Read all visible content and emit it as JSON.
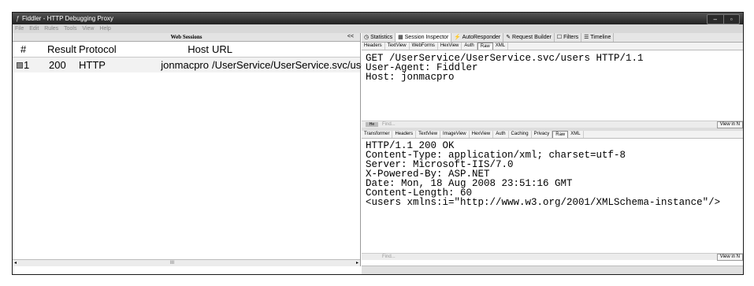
{
  "window": {
    "title": "Fiddler - HTTP Debugging Proxy",
    "minimize": "–",
    "restore": "▫"
  },
  "menu": [
    "File",
    "Edit",
    "Rules",
    "Tools",
    "View",
    "Help"
  ],
  "sessions": {
    "header": "Web Sessions",
    "collapse": "<<",
    "columns": {
      "num": "#",
      "result": "Result",
      "protocol": "Protocol",
      "host": "Host",
      "url": "URL"
    },
    "rows": [
      {
        "num": "1",
        "result": "200",
        "protocol": "HTTP",
        "host": "jonmacpro",
        "url": "/UserService/UserService.svc/users"
      }
    ],
    "scroll": {
      "left": "◂",
      "thumb": "III",
      "right": "▸"
    }
  },
  "inspector_tabs": [
    "Statistics",
    "Session Inspector",
    "AutoResponder",
    "Request Builder",
    "Filters",
    "Timeline"
  ],
  "request": {
    "tabs": [
      "Headers",
      "TextView",
      "WebForms",
      "HexView",
      "Auth",
      "Raw",
      "XML"
    ],
    "lines": [
      "GET /UserService/UserService.svc/users HTTP/1.1",
      "User-Agent: Fiddler",
      "Host: jonmacpro"
    ],
    "find_placeholder": "Find...",
    "hex_label": "He",
    "view_in": "View in N"
  },
  "response": {
    "tabs": [
      "Transformer",
      "Headers",
      "TextView",
      "ImageView",
      "HexView",
      "Auth",
      "Caching",
      "Privacy",
      "Raw",
      "XML"
    ],
    "lines": [
      "HTTP/1.1 200 OK",
      "Content-Type: application/xml; charset=utf-8",
      "Server: Microsoft-IIS/7.0",
      "X-Powered-By: ASP.NET",
      "Date: Mon, 18 Aug 2008 23:51:16 GMT",
      "Content-Length: 60",
      "",
      "<users xmlns:i=\"http://www.w3.org/2001/XMLSchema-instance\"/>"
    ],
    "find_placeholder": "Find...",
    "view_in": "View in N"
  }
}
